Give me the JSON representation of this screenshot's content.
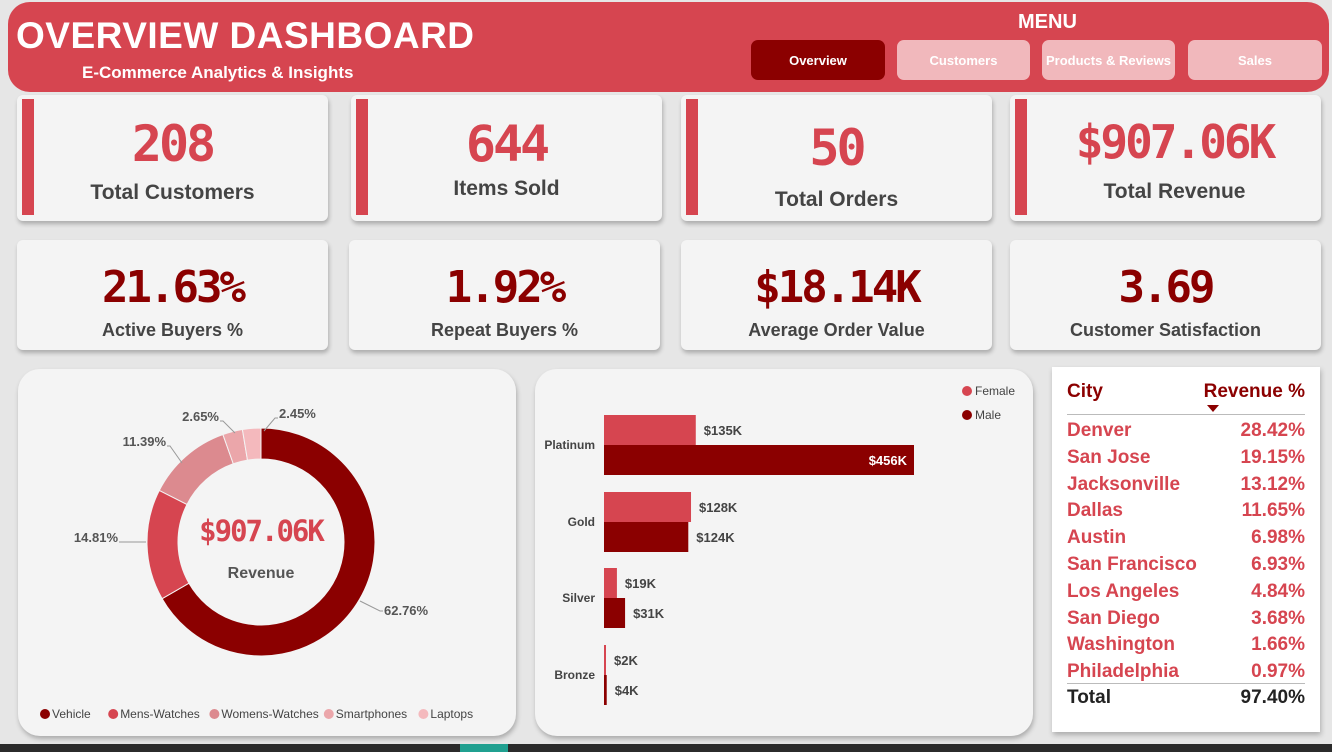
{
  "header": {
    "title": "OVERVIEW DASHBOARD",
    "subtitle": "E-Commerce Analytics & Insights",
    "menu_label": "MENU",
    "nav": [
      "Overview",
      "Customers",
      "Products & Reviews",
      "Sales"
    ],
    "active_nav": "Overview"
  },
  "kpi_row1": [
    {
      "value": "208",
      "label": "Total Customers"
    },
    {
      "value": "644",
      "label": "Items Sold"
    },
    {
      "value": "50",
      "label": "Total Orders"
    },
    {
      "value": "$907.06K",
      "label": "Total Revenue"
    }
  ],
  "kpi_row2": [
    {
      "value": "21.63%",
      "label": "Active Buyers %"
    },
    {
      "value": "1.92%",
      "label": "Repeat Buyers %"
    },
    {
      "value": "$18.14K",
      "label": "Average Order Value"
    },
    {
      "value": "3.69",
      "label": "Customer Satisfaction"
    }
  ],
  "colors": {
    "accent": "#d64550",
    "dark_red": "#8b0000",
    "pink_light": "#f1b8bc"
  },
  "chart_data": [
    {
      "type": "pie",
      "center_value": "$907.06K",
      "center_label": "Revenue",
      "categories": [
        "Vehicle",
        "Mens-Watches",
        "Womens-Watches",
        "Smartphones",
        "Laptops"
      ],
      "values": [
        62.76,
        14.81,
        11.39,
        2.65,
        2.45
      ],
      "labels": [
        "62.76%",
        "14.81%",
        "11.39%",
        "2.65%",
        "2.45%"
      ],
      "colors": [
        "#8b0000",
        "#d64550",
        "#dc8a8f",
        "#eba6aa",
        "#f4b9bd"
      ],
      "legend_position": "bottom"
    },
    {
      "type": "bar",
      "orientation": "horizontal",
      "categories": [
        "Platinum",
        "Gold",
        "Silver",
        "Bronze"
      ],
      "series": [
        {
          "name": "Female",
          "values": [
            135,
            128,
            19,
            2
          ],
          "labels": [
            "$135K",
            "$128K",
            "$19K",
            "$2K"
          ],
          "color": "#d64550"
        },
        {
          "name": "Male",
          "values": [
            456,
            124,
            31,
            4
          ],
          "labels": [
            "$456K",
            "$124K",
            "$31K",
            "$4K"
          ],
          "color": "#8b0000"
        }
      ],
      "legend_position": "top-right"
    },
    {
      "type": "table",
      "columns": [
        "City",
        "Revenue %"
      ],
      "rows": [
        [
          "Denver",
          "28.42%"
        ],
        [
          "San Jose",
          "19.15%"
        ],
        [
          "Jacksonville",
          "13.12%"
        ],
        [
          "Dallas",
          "11.65%"
        ],
        [
          "Austin",
          "6.98%"
        ],
        [
          "San Francisco",
          "6.93%"
        ],
        [
          "Los Angeles",
          "4.84%"
        ],
        [
          "San Diego",
          "3.68%"
        ],
        [
          "Washington",
          "1.66%"
        ],
        [
          "Philadelphia",
          "0.97%"
        ]
      ],
      "total": [
        "Total",
        "97.40%"
      ],
      "sort_column": "Revenue %"
    }
  ]
}
